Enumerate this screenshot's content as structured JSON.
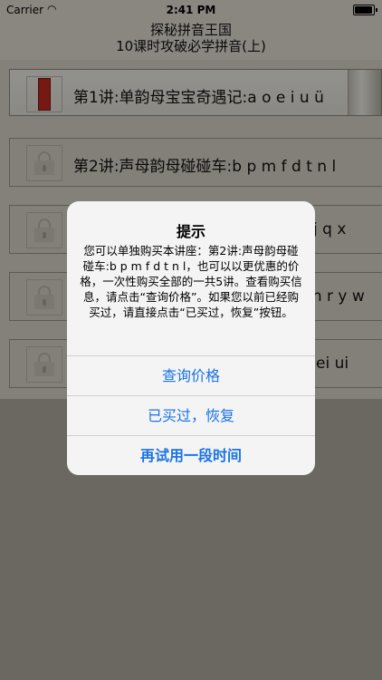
{
  "status_bar": {
    "carrier": "Carrier",
    "time": "2:41 PM"
  },
  "nav": {
    "title_line1": "探秘拼音王国",
    "title_line2": "10课时攻破必学拼音(上)"
  },
  "lessons": [
    {
      "label": "第1讲:单韵母宝宝奇遇记:a o e i u ü",
      "state": "unlocked"
    },
    {
      "label": "第2讲:声母韵母碰碰车:b p m f d t n l",
      "state": "locked"
    },
    {
      "label": "j q x",
      "state": "locked"
    },
    {
      "label": "sh r y w",
      "state": "locked"
    },
    {
      "label": "ei ui",
      "state": "locked"
    }
  ],
  "alert": {
    "title": "提示",
    "message": "您可以单独购买本讲座：第2讲:声母韵母碰碰车:b p m f d t n l，也可以以更优惠的价格，一次性购买全部的一共5讲。查看购买信息，请点击“查询价格”。如果您以前已经购买过，请直接点击“已买过，恢复”按钮。",
    "buttons": [
      "查询价格",
      "已买过，恢复",
      "再试用一段时间"
    ]
  },
  "colors": {
    "alert_button": "#1a73e6",
    "book": "#c42a1e"
  }
}
